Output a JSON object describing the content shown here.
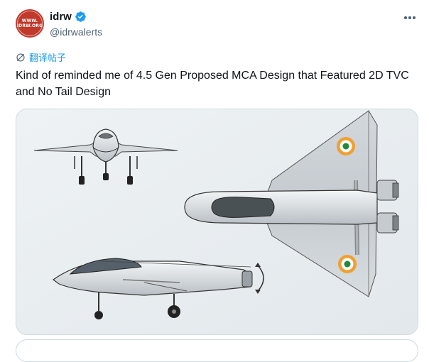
{
  "author": {
    "display_name": "idrw",
    "handle": "@idrwalerts",
    "avatar_text": [
      "WWW.",
      "IDRW.ORG"
    ]
  },
  "translate_label": "翻译帖子",
  "tweet_text": "Kind of reminded me of 4.5 Gen Proposed MCA Design that Featured 2D TVC and No Tail Design",
  "media": {
    "description_icon": "aircraft-three-view-drawing"
  },
  "colors": {
    "link_blue": "#1d9bf0",
    "secondary_text": "#536471",
    "avatar_red": "#c0392b",
    "roundel_saffron": "#f0a030",
    "roundel_green": "#1f8a3a"
  }
}
